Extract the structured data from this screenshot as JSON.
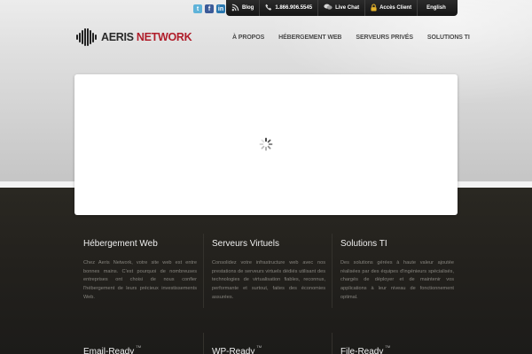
{
  "social": {
    "twitter_glyph": "t",
    "facebook_glyph": "f",
    "linkedin_glyph": "in"
  },
  "topbar": {
    "blog_label": "Blog",
    "phone_label": "1.866.906.5545",
    "livechat_label": "Live Chat",
    "client_access_label": "Accès Client",
    "language_label": "English"
  },
  "logo": {
    "part1": "AERIS",
    "part2": "NETWORK"
  },
  "nav": {
    "items": [
      "À PROPOS",
      "HÉBERGEMENT WEB",
      "SERVEURS PRIVÉS",
      "SOLUTIONS TI"
    ]
  },
  "columns": [
    {
      "title": "Hébergement Web",
      "text": "Chez Aeris Network, votre site web est entre bonnes mains. C'est pourquoi de nombreuses entreprises ont choisi de nous confier l'hébergement de leurs précieux investissements Web."
    },
    {
      "title": "Serveurs Virtuels",
      "text": "Consolidez votre infrastructure web avec nos prestations de serveurs virtuels dédiés utilisant des technologies de virtualisation fiables, reconnus, performante et surtout, faites des économies assurées."
    },
    {
      "title": "Solutions TI",
      "text": "Des solutions gérées à haute valeur ajoutée réalisées par des équipes d'ingénieurs spécialisés, chargés de déployer et de maintenir vos applications à leur niveau de fonctionnement optimal."
    }
  ],
  "bottom_titles": [
    {
      "title": "Email-Ready",
      "mark": "TM"
    },
    {
      "title": "WP-Ready",
      "mark": "TM"
    },
    {
      "title": "File-Ready",
      "mark": "TM"
    }
  ],
  "colors": {
    "brand_red": "#b01d2a",
    "dark_bg": "#23211d",
    "lock_yellow": "#e5b32b"
  }
}
